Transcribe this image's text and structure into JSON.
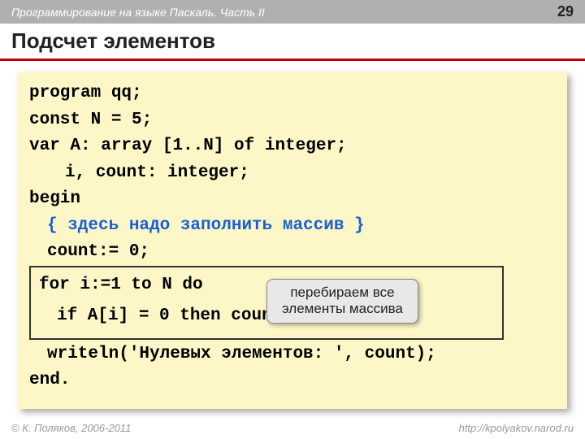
{
  "header": {
    "course": "Программирование на языке Паскаль. Часть II",
    "page": "29"
  },
  "title": "Подсчет элементов",
  "code": {
    "l1": "program qq;",
    "l2": "const N = 5;",
    "l3": "var A: array [1..N] of integer;",
    "l4": "i, count: integer;",
    "l5": "begin",
    "l6": "{ здесь надо заполнить массив }",
    "l7": "count:= 0;",
    "l8": "for i:=1 to N do",
    "l9": "if A[i] = 0 then count:= count + 1;",
    "l10": "writeln('Нулевых элементов: ', count);",
    "l11": "end."
  },
  "callout": {
    "line1": "перебираем все",
    "line2": "элементы массива"
  },
  "footer": {
    "copyright": "© К. Поляков, 2006-2011",
    "url": "http://kpolyakov.narod.ru"
  }
}
